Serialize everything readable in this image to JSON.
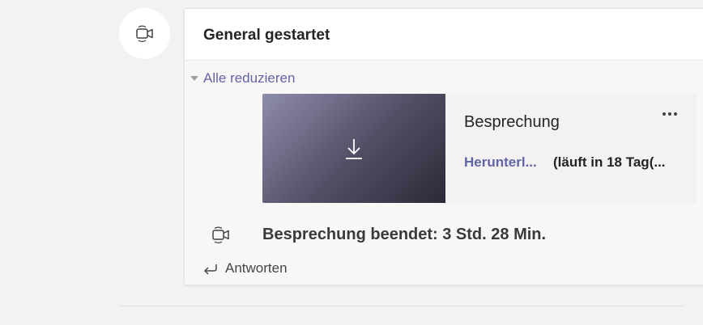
{
  "meeting": {
    "title": "General gestartet",
    "collapse_label": "Alle reduzieren",
    "recording": {
      "title": "Besprechung",
      "download_label": "Herunterl...",
      "expiry_text": "(läuft in 18 Tag(..."
    },
    "ended_text": "Besprechung beendet: 3 Std. 28 Min.",
    "reply_label": "Antworten"
  },
  "icons": {
    "meeting": "video-camera-icon",
    "download": "download-icon",
    "more": "more-options-icon",
    "collapse": "caret-down-icon",
    "reply": "reply-arrow-icon"
  },
  "colors": {
    "accent": "#6264a7",
    "text": "#252423",
    "background": "#f3f2f1"
  }
}
